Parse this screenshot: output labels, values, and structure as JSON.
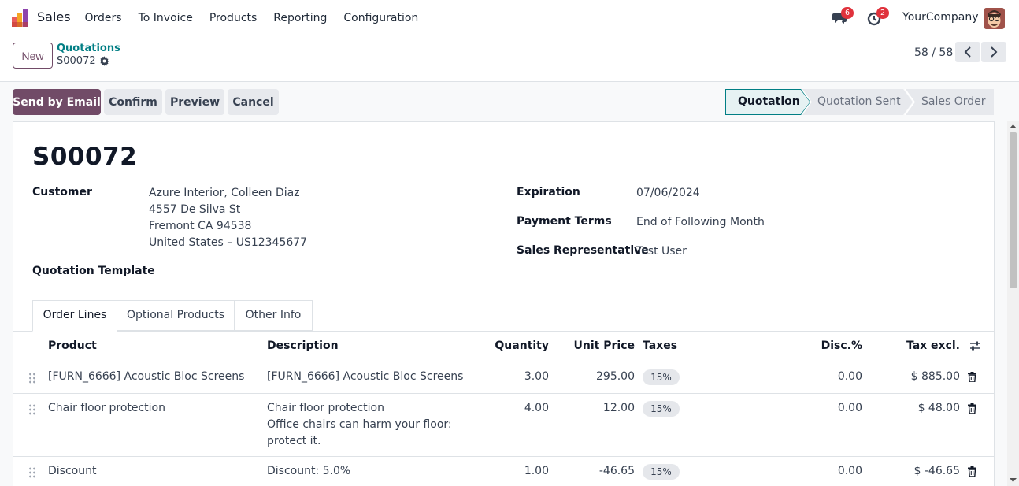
{
  "navbar": {
    "app_name": "Sales",
    "menu": [
      "Orders",
      "To Invoice",
      "Products",
      "Reporting",
      "Configuration"
    ],
    "messages_count": "6",
    "activities_count": "2",
    "company": "YourCompany"
  },
  "control": {
    "new_label": "New",
    "breadcrumb": "Quotations",
    "record": "S00072",
    "pager": "58 / 58"
  },
  "actions": {
    "send_email": "Send by Email",
    "confirm": "Confirm",
    "preview": "Preview",
    "cancel": "Cancel"
  },
  "status": {
    "stages": [
      "Quotation",
      "Quotation Sent",
      "Sales Order"
    ],
    "current": "Quotation"
  },
  "form": {
    "title": "S00072",
    "customer_label": "Customer",
    "customer_lines": [
      "Azure Interior, Colleen Diaz",
      "4557 De Silva St",
      "Fremont CA 94538",
      "United States – US12345677"
    ],
    "template_label": "Quotation Template",
    "expiration_label": "Expiration",
    "expiration": "07/06/2024",
    "payment_terms_label": "Payment Terms",
    "payment_terms": "End of Following Month",
    "salesrep_label": "Sales Representative",
    "salesrep": "Test User"
  },
  "tabs": [
    "Order Lines",
    "Optional Products",
    "Other Info"
  ],
  "table": {
    "headers": {
      "product": "Product",
      "description": "Description",
      "quantity": "Quantity",
      "unit_price": "Unit Price",
      "taxes": "Taxes",
      "disc": "Disc.%",
      "tax_excl": "Tax excl."
    },
    "rows": [
      {
        "product": "[FURN_6666] Acoustic Bloc Screens",
        "desc1": "[FURN_6666] Acoustic Bloc Screens",
        "desc2": "",
        "desc3": "",
        "qty": "3.00",
        "price": "295.00",
        "tax": "15%",
        "disc": "0.00",
        "total": "$ 885.00"
      },
      {
        "product": "Chair floor protection",
        "desc1": "Chair floor protection",
        "desc2": "Office chairs can harm your floor:",
        "desc3": "protect it.",
        "qty": "4.00",
        "price": "12.00",
        "tax": "15%",
        "disc": "0.00",
        "total": "$ 48.00"
      },
      {
        "product": "Discount",
        "desc1": "Discount: 5.0%",
        "desc2": "",
        "desc3": "",
        "qty": "1.00",
        "price": "-46.65",
        "tax": "15%",
        "disc": "0.00",
        "total": "$ -46.65"
      }
    ]
  },
  "colors": {
    "primary": "#714b67",
    "link": "#017e84",
    "badge": "#e0323c"
  }
}
